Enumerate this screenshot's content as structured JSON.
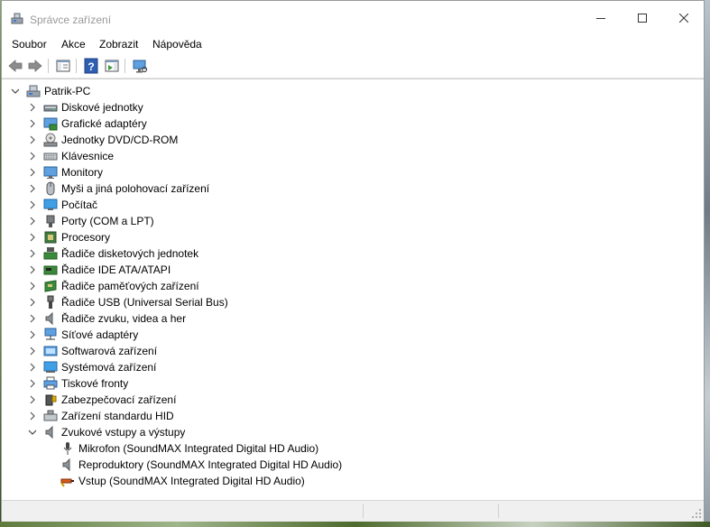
{
  "window": {
    "title": "Správce zařízení"
  },
  "menu": {
    "items": [
      {
        "label": "Soubor"
      },
      {
        "label": "Akce"
      },
      {
        "label": "Zobrazit"
      },
      {
        "label": "Nápověda"
      }
    ]
  },
  "tree": {
    "root": {
      "label": "Patrik-PC",
      "expanded": true
    },
    "categories": [
      {
        "label": "Diskové jednotky",
        "icon": "disk-drive-icon"
      },
      {
        "label": "Grafické adaptéry",
        "icon": "display-adapter-icon"
      },
      {
        "label": "Jednotky DVD/CD-ROM",
        "icon": "dvd-drive-icon"
      },
      {
        "label": "Klávesnice",
        "icon": "keyboard-icon"
      },
      {
        "label": "Monitory",
        "icon": "monitor-icon"
      },
      {
        "label": "Myši a jiná polohovací zařízení",
        "icon": "mouse-icon"
      },
      {
        "label": "Počítač",
        "icon": "computer-icon"
      },
      {
        "label": "Porty (COM a LPT)",
        "icon": "port-icon"
      },
      {
        "label": "Procesory",
        "icon": "processor-icon"
      },
      {
        "label": "Řadiče disketových jednotek",
        "icon": "floppy-controller-icon"
      },
      {
        "label": "Řadiče IDE ATA/ATAPI",
        "icon": "ide-controller-icon"
      },
      {
        "label": "Řadiče paměťových zařízení",
        "icon": "storage-controller-icon"
      },
      {
        "label": "Řadiče USB (Universal Serial Bus)",
        "icon": "usb-icon"
      },
      {
        "label": "Řadiče zvuku, videa a her",
        "icon": "sound-controller-icon"
      },
      {
        "label": "Síťové adaptéry",
        "icon": "network-adapter-icon"
      },
      {
        "label": "Softwarová zařízení",
        "icon": "software-device-icon"
      },
      {
        "label": "Systémová zařízení",
        "icon": "system-device-icon"
      },
      {
        "label": "Tiskové fronty",
        "icon": "printer-icon"
      },
      {
        "label": "Zabezpečovací zařízení",
        "icon": "security-device-icon"
      },
      {
        "label": "Zařízení standardu HID",
        "icon": "hid-icon"
      },
      {
        "label": "Zvukové vstupy a výstupy",
        "icon": "audio-io-icon",
        "expanded": true
      }
    ],
    "children": [
      {
        "label": "Mikrofon (SoundMAX Integrated Digital HD Audio)",
        "icon": "microphone-icon"
      },
      {
        "label": "Reproduktory (SoundMAX Integrated Digital HD Audio)",
        "icon": "speaker-icon"
      },
      {
        "label": "Vstup (SoundMAX Integrated Digital HD Audio)",
        "icon": "line-in-icon"
      }
    ]
  }
}
